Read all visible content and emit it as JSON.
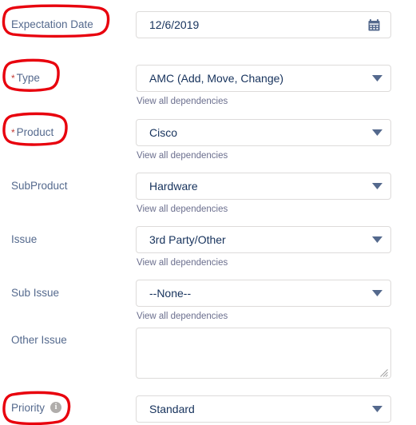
{
  "form": {
    "dependency_link_label": "View all dependencies",
    "fields": [
      {
        "id": "expectation-date",
        "label": "Expectation Date",
        "required": false,
        "control": "date-input",
        "value": "12/6/2019",
        "placeholder": "",
        "icon": "calendar-icon",
        "has_dependency_link": false,
        "annotated": true
      },
      {
        "id": "type",
        "label": "Type",
        "required": true,
        "control": "select",
        "value": "AMC (Add, Move, Change)",
        "icon": "chevron-down-icon",
        "has_dependency_link": true,
        "annotated": true
      },
      {
        "id": "product",
        "label": "Product",
        "required": true,
        "control": "select",
        "value": "Cisco",
        "icon": "chevron-down-icon",
        "has_dependency_link": true,
        "annotated": true
      },
      {
        "id": "subproduct",
        "label": "SubProduct",
        "required": false,
        "control": "select",
        "value": "Hardware",
        "icon": "chevron-down-icon",
        "has_dependency_link": true,
        "annotated": false
      },
      {
        "id": "issue",
        "label": "Issue",
        "required": false,
        "control": "select",
        "value": "3rd Party/Other",
        "icon": "chevron-down-icon",
        "has_dependency_link": true,
        "annotated": false
      },
      {
        "id": "sub-issue",
        "label": "Sub Issue",
        "required": false,
        "control": "select",
        "value": "--None--",
        "icon": "chevron-down-icon",
        "has_dependency_link": true,
        "annotated": false
      },
      {
        "id": "other-issue",
        "label": "Other Issue",
        "required": false,
        "control": "textarea",
        "value": "",
        "placeholder": "",
        "icon": "resize-grip-icon",
        "has_dependency_link": false,
        "annotated": false
      },
      {
        "id": "priority",
        "label": "Priority",
        "required": false,
        "control": "select",
        "value": "Standard",
        "icon": "chevron-down-icon",
        "info_icon": "info-icon",
        "info_icon_glyph": "i",
        "has_dependency_link": false,
        "annotated": true
      }
    ]
  },
  "colors": {
    "required_asterisk": "#c23934",
    "label_text": "#54698d",
    "value_text": "#16325c",
    "field_border": "#dddbda",
    "dropdown_arrow": "#54698d",
    "calendar_icon": "#54698d",
    "dependency_link": "#6b6f8e",
    "annotation_highlight": "#e8000d",
    "info_icon_background": "#b0adab",
    "page_background": "#ffffff"
  }
}
